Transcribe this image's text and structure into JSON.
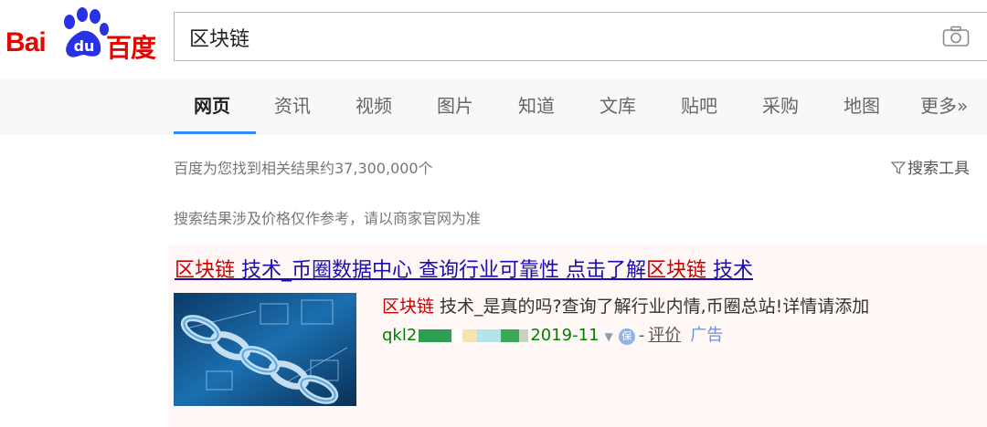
{
  "header": {
    "logo_text_latin": "Bai",
    "logo_text_du": "du",
    "logo_text_cn": "百度",
    "search_value": "区块链",
    "camera_icon": "camera-icon"
  },
  "tabs": [
    {
      "label": "网页",
      "active": true
    },
    {
      "label": "资讯"
    },
    {
      "label": "视频"
    },
    {
      "label": "图片"
    },
    {
      "label": "知道"
    },
    {
      "label": "文库"
    },
    {
      "label": "贴吧"
    },
    {
      "label": "采购"
    },
    {
      "label": "地图"
    },
    {
      "label": "更多»"
    }
  ],
  "results": {
    "count_text": "百度为您找到相关结果约37,300,000个",
    "tools_label": "搜索工具",
    "disclaimer": "搜索结果涉及价格仅作参考，请以商家官网为准"
  },
  "ad": {
    "title_parts": [
      "区块链",
      " 技术_币圈数据中心 查询行业可靠性 点击了解",
      "区块链",
      " 技术"
    ],
    "desc_highlight": "区块链",
    "desc_rest": " 技术_是真的吗?查询了解行业内情,币圈总站!详情请添加",
    "url_prefix": "qkl2",
    "url_suffix": "2019-11",
    "protect_label": "保",
    "review_label": "评价",
    "sep": "-",
    "ad_label": "广告"
  },
  "colors": {
    "brand_red": "#e10601",
    "link_blue": "#1a0dab",
    "highlight_red": "#cc0000",
    "url_green": "#008000",
    "tab_accent": "#3388ff"
  }
}
